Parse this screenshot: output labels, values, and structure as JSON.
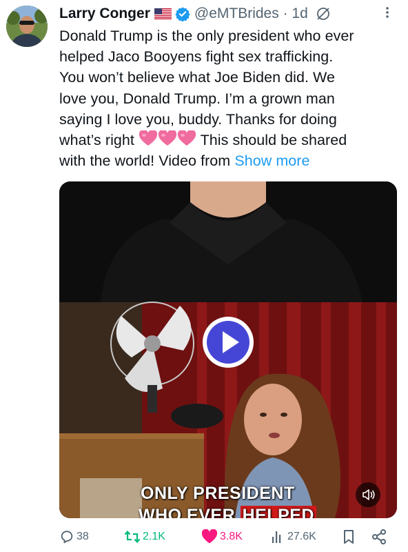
{
  "author": {
    "name": "Larry Conger",
    "handle": "@eMTBrides",
    "separator": "·",
    "time": "1d"
  },
  "icons": {
    "flag": "us-flag-icon",
    "verified": "verified-badge-icon",
    "grok": "grok-icon",
    "more": "more-options-icon"
  },
  "tweet": {
    "lines": [
      "Donald Trump is the only president who ever",
      "helped Jaco Booyens fight sex trafficking.",
      "You won’t believe what Joe Biden did. We",
      "love you, Donald Trump. I’m a grown man",
      "saying I love you, buddy. Thanks for doing"
    ],
    "line6_before": "what’s right",
    "line6_after": " This should be shared",
    "line7": "with the world! Video from",
    "show_more": "Show more",
    "emoji": "💗💗💗"
  },
  "media": {
    "caption_line1": "ONLY PRESIDENT",
    "caption_line2_a": "WHO EVER",
    "caption_line2_b": "HELPED"
  },
  "actions": {
    "replies": "38",
    "reposts": "2.1K",
    "likes": "3.8K",
    "views": "27.6K"
  },
  "colors": {
    "accent": "#1d9bf0",
    "like": "#f91880",
    "repost": "#00ba7c",
    "muted": "#536471",
    "play_button": "#4646d6"
  }
}
